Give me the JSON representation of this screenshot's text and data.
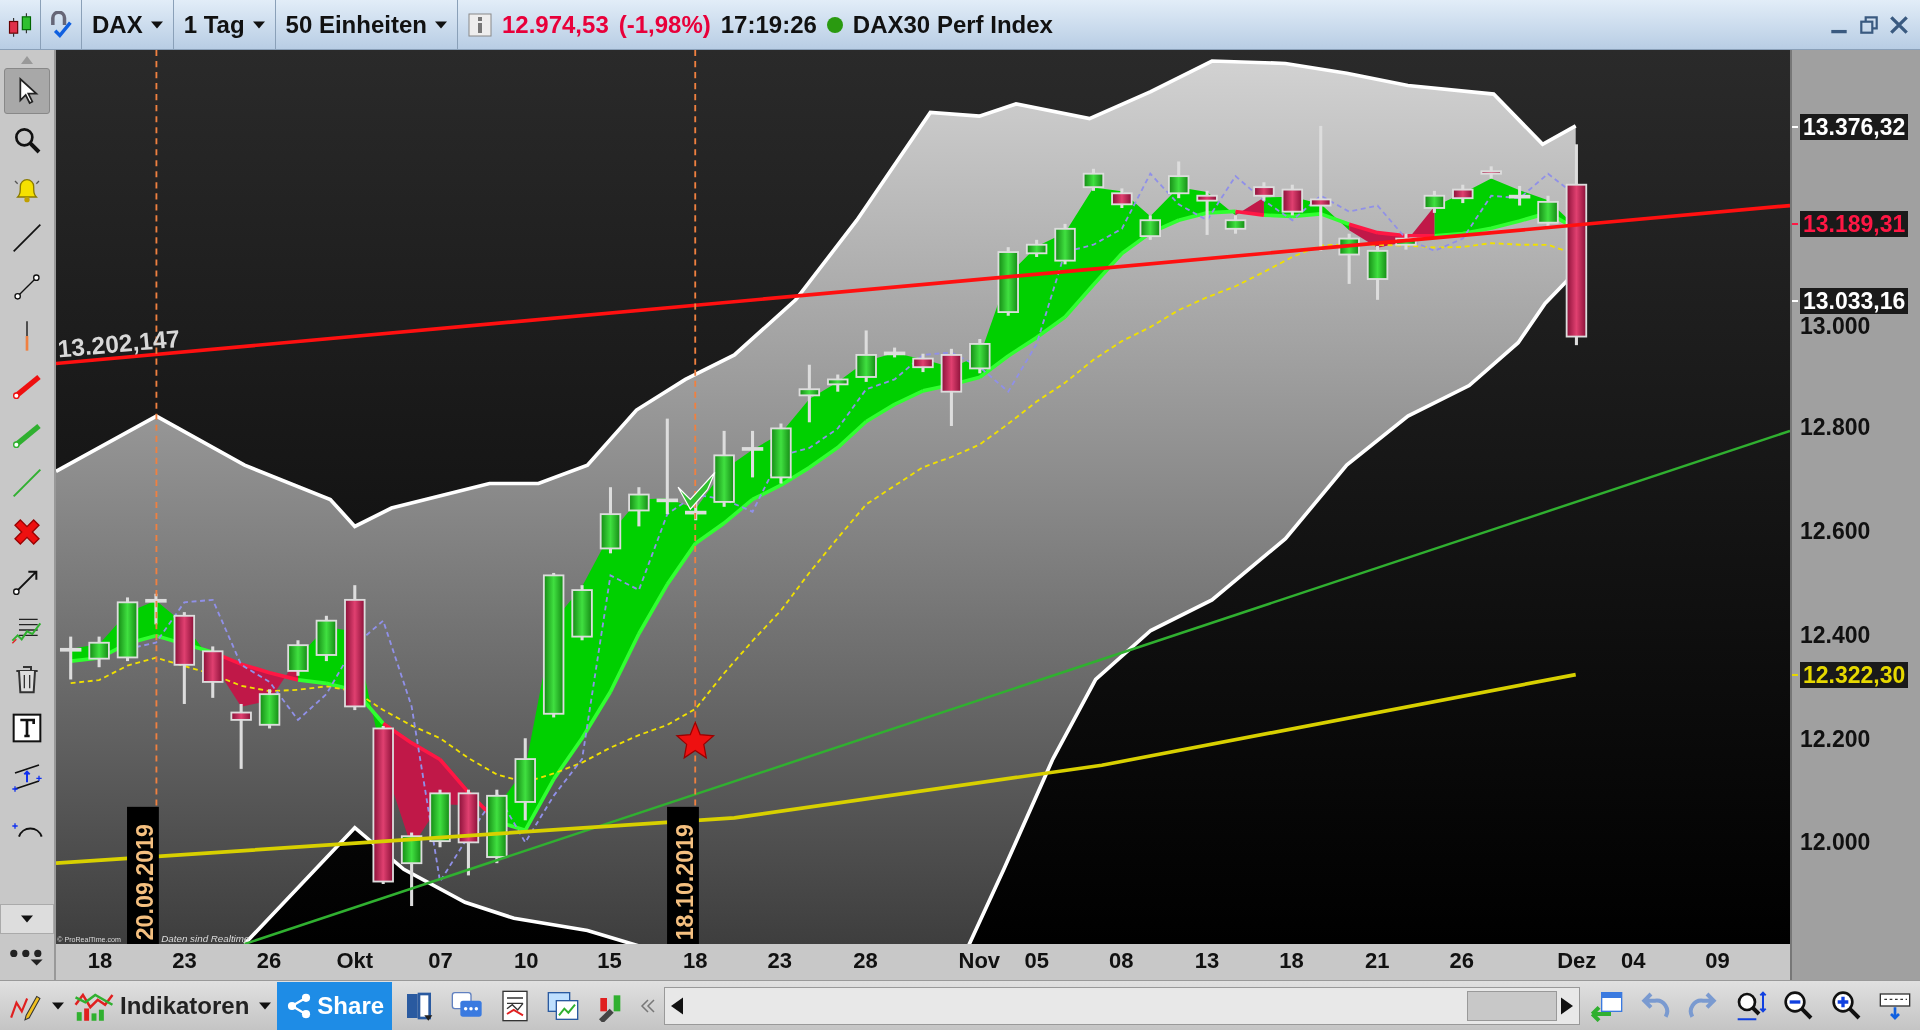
{
  "toolbar": {
    "symbol": "DAX",
    "interval": "1 Tag",
    "units": "50 Einheiten",
    "price": "12.974,53",
    "change": "(-1,98%)",
    "time": "17:19:26",
    "market_open": true,
    "instrument": "DAX30 Perf Index"
  },
  "tools": [
    {
      "kind": "pointer",
      "selected": true
    },
    {
      "kind": "zoom",
      "selected": false
    },
    {
      "kind": "alert",
      "selected": false
    },
    {
      "kind": "line",
      "selected": false
    },
    {
      "kind": "segment",
      "selected": false
    },
    {
      "kind": "vline",
      "selected": false
    },
    {
      "kind": "redline",
      "selected": false
    },
    {
      "kind": "greenline",
      "selected": false
    },
    {
      "kind": "thinline",
      "selected": false
    },
    {
      "kind": "delete",
      "selected": false
    },
    {
      "kind": "arrow",
      "selected": false
    },
    {
      "kind": "fib",
      "selected": false
    },
    {
      "kind": "trash",
      "selected": false
    },
    {
      "kind": "text",
      "selected": false
    },
    {
      "kind": "channel",
      "selected": false
    },
    {
      "kind": "arc",
      "selected": false
    }
  ],
  "chart": {
    "annotation": "13.202,147",
    "date_markers": [
      "20.09.2019",
      "18.10.2019"
    ],
    "copyright": "© ProRealTime.com",
    "notice": "Daten sind Realtime",
    "price_ticks": [
      "13.000",
      "12.800",
      "12.600",
      "12.400",
      "12.200",
      "12.000"
    ],
    "price_markers": [
      {
        "text": "13.376,32",
        "color": "#ffffff"
      },
      {
        "text": "13.189,31",
        "color": "#ff1744"
      },
      {
        "text": "13.033,16",
        "color": "#ffffff"
      },
      {
        "text": "12.322,30",
        "color": "#e6d800"
      }
    ],
    "dates": [
      "18",
      "23",
      "26",
      "Okt",
      "07",
      "10",
      "15",
      "18",
      "23",
      "28",
      "Nov",
      "05",
      "08",
      "13",
      "18",
      "21",
      "26",
      "Dez",
      "04",
      "09"
    ]
  },
  "bottom_toolbar": {
    "indicators": "Indikatoren",
    "share": "Share"
  }
}
